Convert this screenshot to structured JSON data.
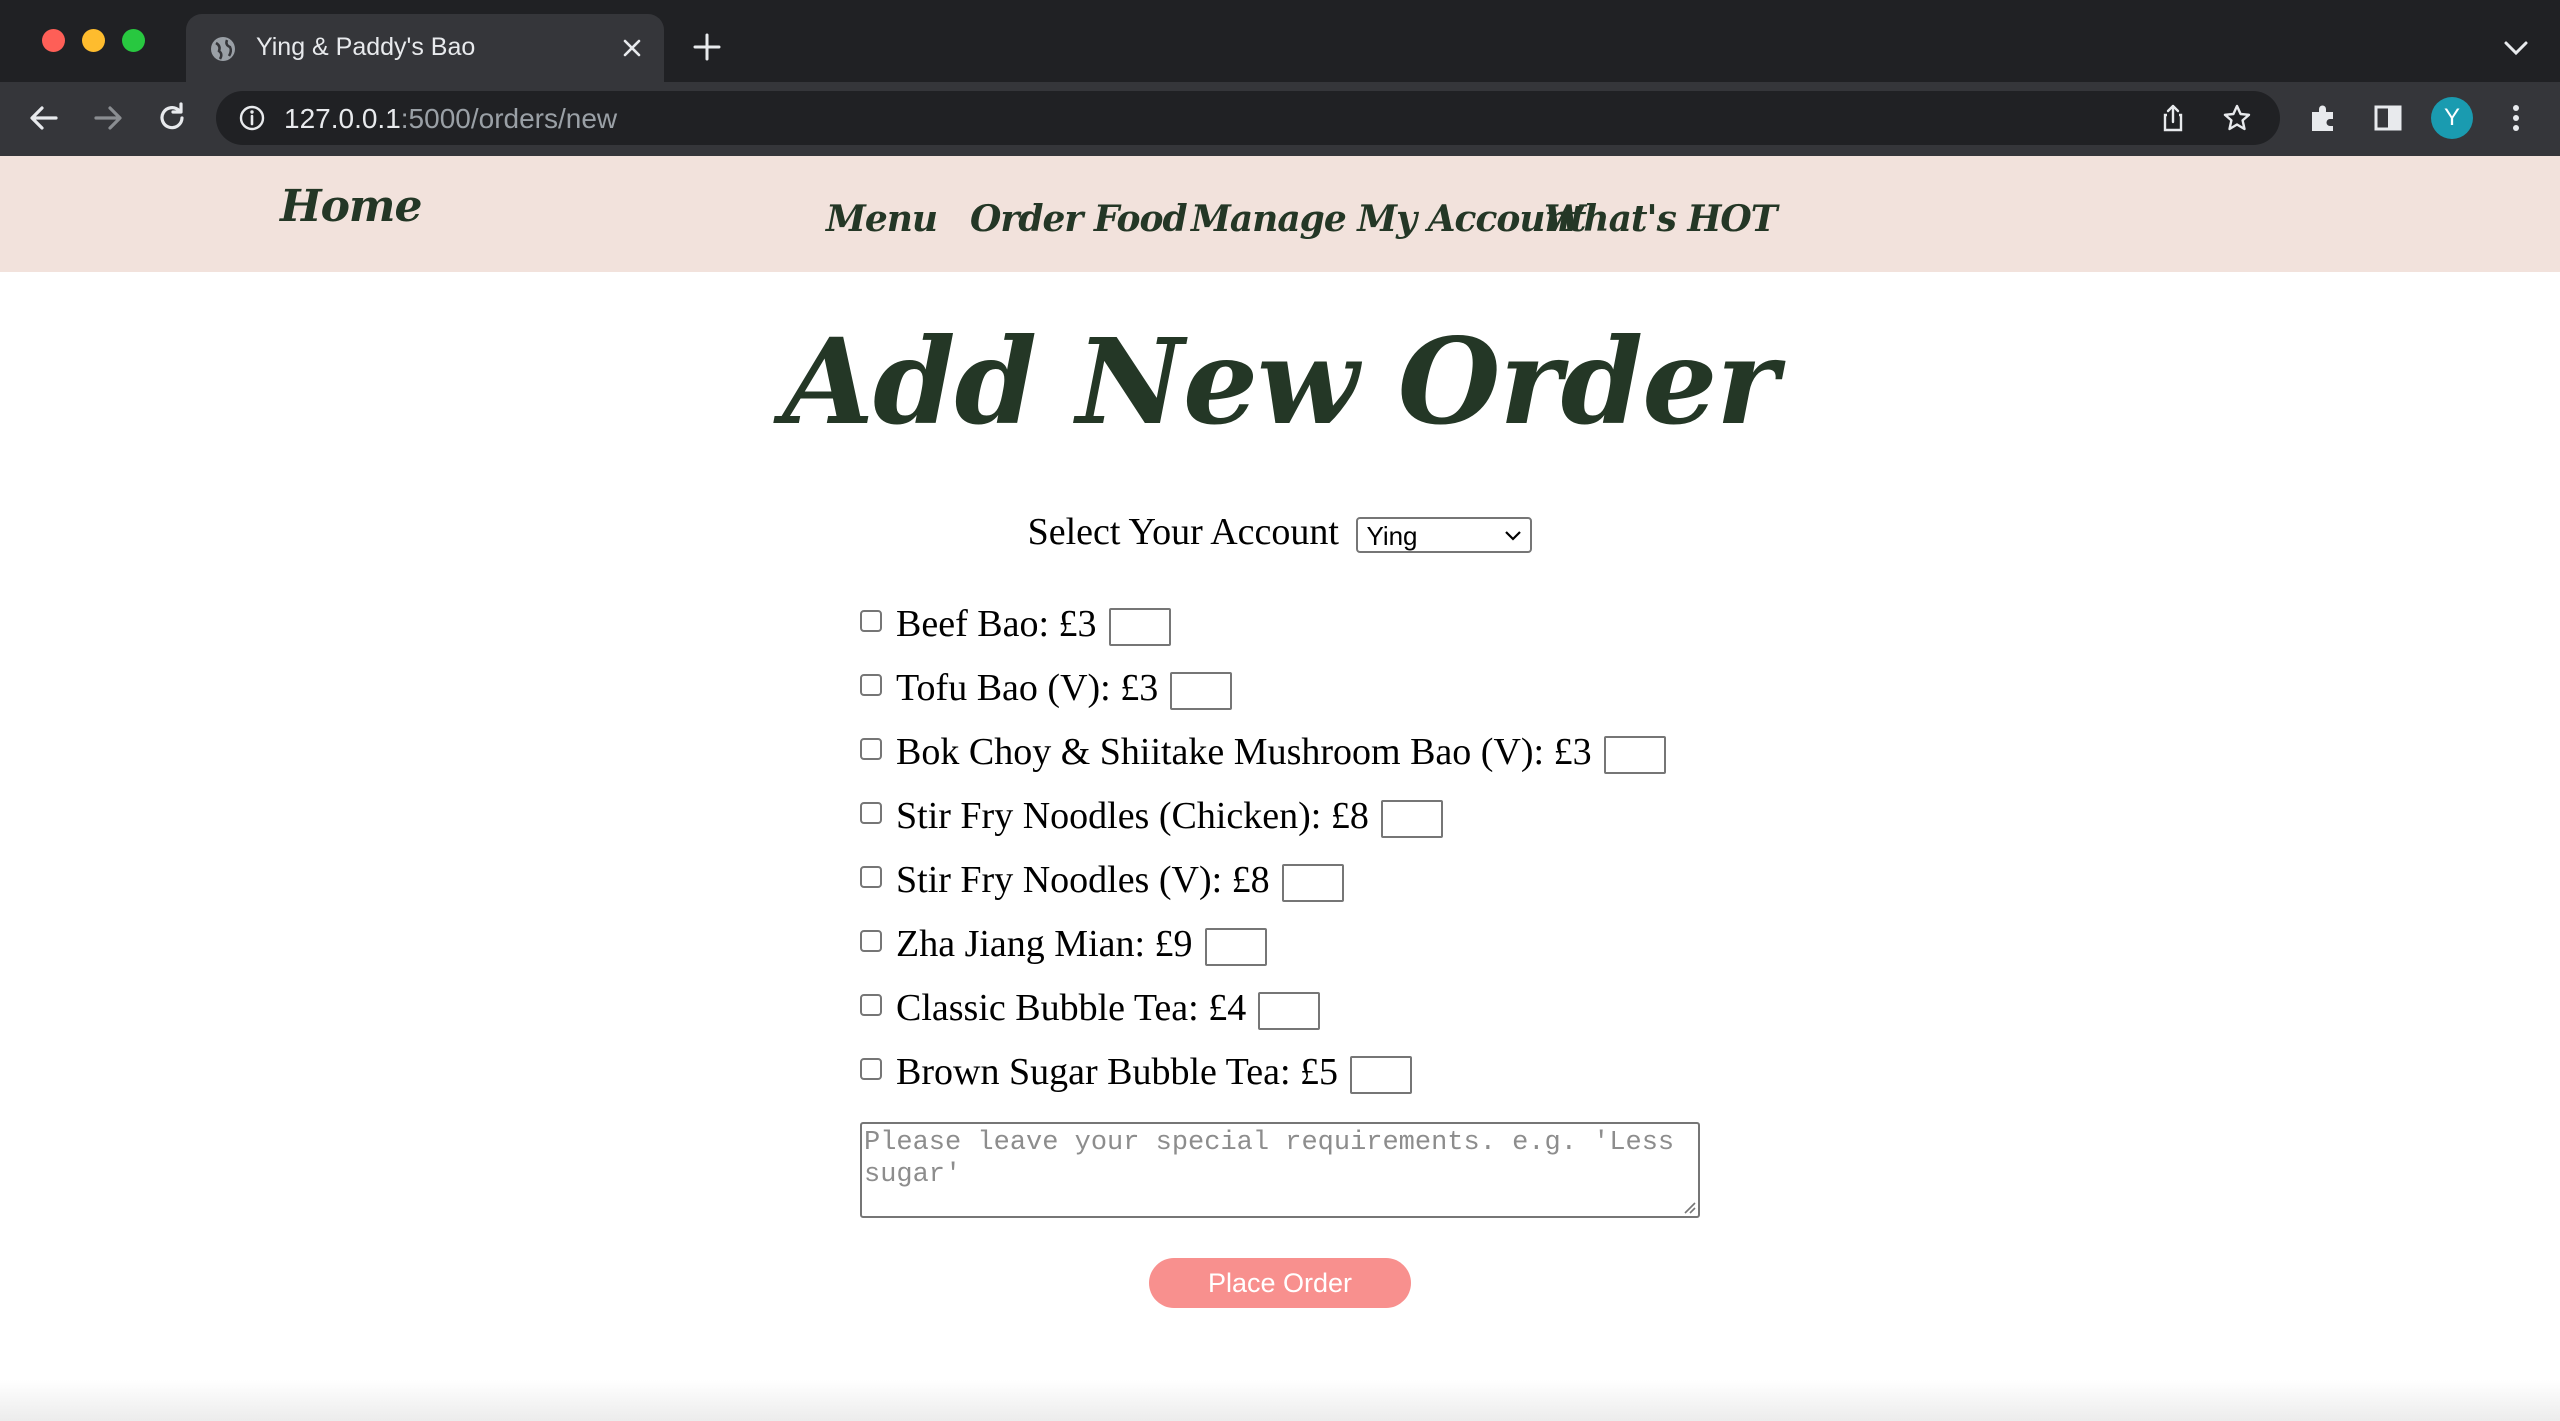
{
  "browser": {
    "tab_title": "Ying & Paddy's Bao",
    "url_host": "127.0.0.1",
    "url_rest": ":5000/orders/new",
    "profile_initial": "Y"
  },
  "nav": {
    "home": "Home",
    "links": [
      "Menu",
      "Order Food",
      "Manage My Account",
      "What's HOT"
    ]
  },
  "page": {
    "title": "Add New Order",
    "account_label": "Select Your Account",
    "account_selected": "Ying"
  },
  "items": [
    {
      "label": "Beef Bao: £3",
      "checked": false
    },
    {
      "label": "Tofu Bao (V): £3",
      "checked": false
    },
    {
      "label": "Bok Choy & Shiitake Mushroom Bao (V): £3",
      "checked": false
    },
    {
      "label": "Stir Fry Noodles (Chicken): £8",
      "checked": false
    },
    {
      "label": "Stir Fry Noodles (V): £8",
      "checked": false
    },
    {
      "label": "Zha Jiang Mian: £9",
      "checked": false
    },
    {
      "label": "Classic Bubble Tea: £4",
      "checked": false
    },
    {
      "label": "Brown Sugar Bubble Tea: £5",
      "checked": false
    }
  ],
  "notes": {
    "placeholder": "Please leave your special requirements. e.g. 'Less sugar'"
  },
  "submit_label": "Place Order",
  "colors": {
    "nav_bg": "#f2e2dc",
    "script_text": "#243726",
    "button_bg": "#f8908e"
  }
}
